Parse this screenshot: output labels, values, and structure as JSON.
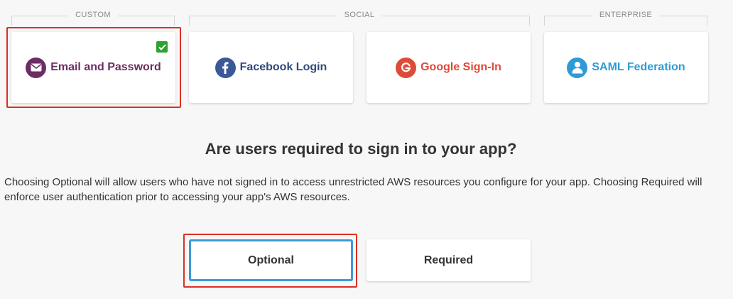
{
  "groups": {
    "custom": "CUSTOM",
    "social": "SOCIAL",
    "enterprise": "ENTERPRISE"
  },
  "providers": [
    {
      "label": "Email and Password",
      "icon": "envelope-icon",
      "color": "#6b2d62",
      "selected": true
    },
    {
      "label": "Facebook Login",
      "icon": "facebook-icon",
      "color": "#3b5998",
      "selected": false
    },
    {
      "label": "Google Sign-In",
      "icon": "google-icon",
      "color": "#dd4b39",
      "selected": false
    },
    {
      "label": "SAML Federation",
      "icon": "user-icon",
      "color": "#2f9bd6",
      "selected": false
    }
  ],
  "question": "Are users required to sign in to your app?",
  "description": "Choosing Optional will allow users who have not signed in to access unrestricted AWS resources you configure for your app. Choosing Required will enforce user authentication prior to accessing your app's AWS resources.",
  "options": {
    "optional": "Optional",
    "required": "Required",
    "selected": "Optional"
  },
  "colors": {
    "highlight": "#d93025",
    "check": "#2ea12f",
    "selected_border": "#3d9ad8"
  }
}
